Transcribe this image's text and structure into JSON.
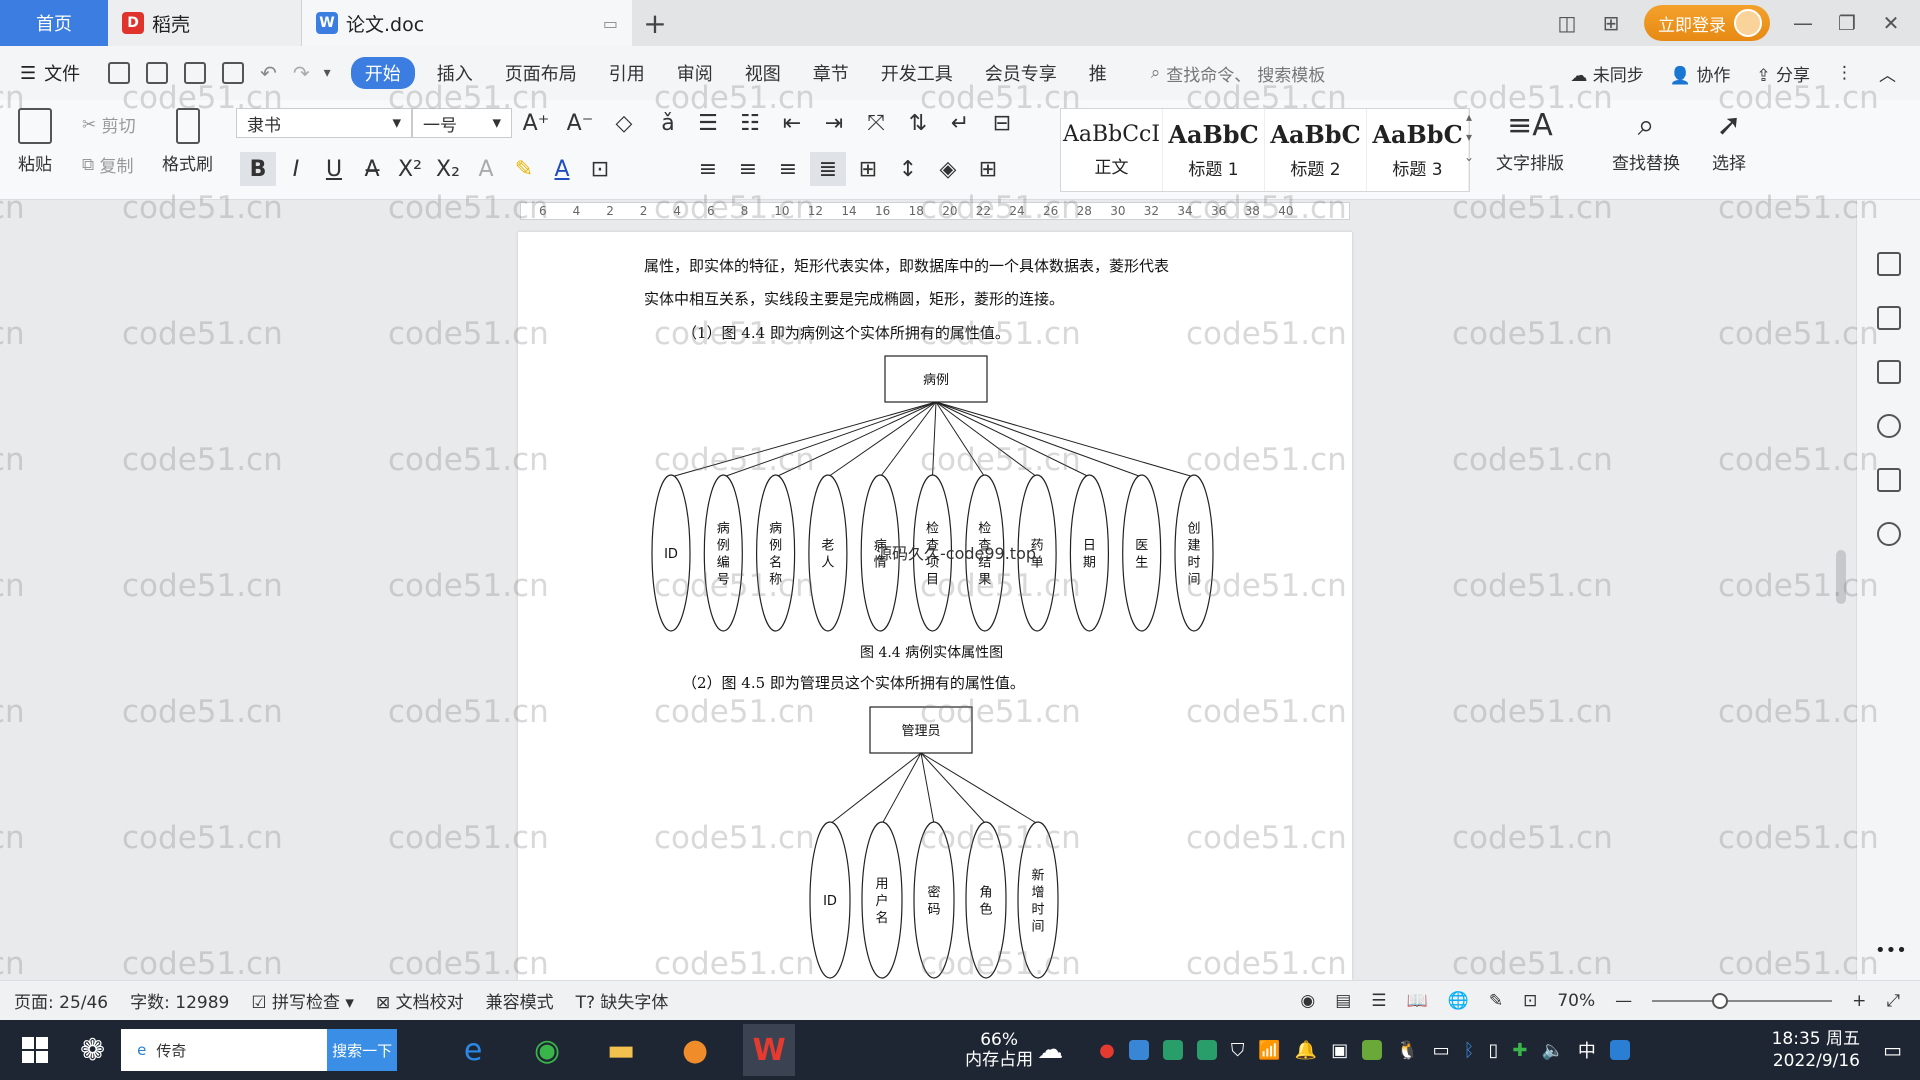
{
  "tabs": {
    "home": "首页",
    "daoke": "稻壳",
    "document": "论文.doc"
  },
  "login_label": "立即登录",
  "menu": {
    "file": "文件",
    "items": [
      "开始",
      "插入",
      "页面布局",
      "引用",
      "审阅",
      "视图",
      "章节",
      "开发工具",
      "会员专享",
      "推"
    ],
    "search_cmd": "查找命令、",
    "search_template": "搜索模板",
    "sync": "未同步",
    "collab": "协作",
    "share": "分享"
  },
  "ribbon": {
    "paste": "粘贴",
    "cut": "剪切",
    "copy": "复制",
    "format_painter": "格式刷",
    "font_name": "隶书",
    "font_size": "一号",
    "styles": [
      {
        "sample": "AaBbCcI",
        "name": "正文"
      },
      {
        "sample": "AaBbC",
        "name": "标题 1"
      },
      {
        "sample": "AaBbC",
        "name": "标题 2"
      },
      {
        "sample": "AaBbC",
        "name": "标题 3"
      }
    ],
    "text_layout": "文字排版",
    "find_replace": "查找替换",
    "select": "选择"
  },
  "ruler_ticks": [
    "6",
    "4",
    "2",
    "2",
    "4",
    "6",
    "8",
    "10",
    "12",
    "14",
    "16",
    "18",
    "20",
    "22",
    "24",
    "26",
    "28",
    "30",
    "32",
    "34",
    "36",
    "38",
    "40"
  ],
  "document": {
    "line1": "属性，即实体的特征，矩形代表实体，即数据库中的一个具体数据表，菱形代表",
    "line2": "实体中相互关系，实线段主要是完成椭圆，矩形，菱形的连接。",
    "item1": "（1）图 4.4 即为病例这个实体所拥有的属性值。",
    "entity1": "病例",
    "attrs1": [
      "ID",
      "病例编号",
      "病例名称",
      "老人",
      "病情",
      "检查项目",
      "检查结果",
      "药单",
      "日期",
      "医生",
      "创建时间"
    ],
    "caption1": "图 4.4  病例实体属性图",
    "item2": "（2）图 4.5 即为管理员这个实体所拥有的属性值。",
    "entity2": "管理员",
    "attrs2": [
      "ID",
      "用户名",
      "密码",
      "角色",
      "新增时间"
    ],
    "overlay_watermark": "源码久久-code99.top"
  },
  "status": {
    "page": "页面: 25/46",
    "words": "字数: 12989",
    "spell": "拼写检查",
    "proof": "文档校对",
    "compat": "兼容模式",
    "missing_font": "缺失字体",
    "zoom": "70%"
  },
  "taskbar": {
    "search_text": "传奇",
    "search_btn": "搜索一下",
    "mem_percent": "66%",
    "mem_label": "内存占用",
    "ime": "中",
    "time": "18:35 周五",
    "date": "2022/9/16"
  },
  "watermark_text": "code51.cn",
  "colors": {
    "accent": "#3b7de0",
    "login": "#e78a14"
  }
}
